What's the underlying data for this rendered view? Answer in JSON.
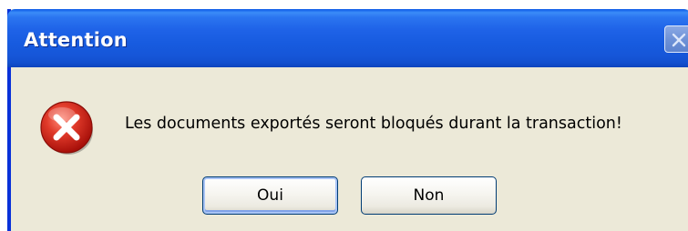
{
  "dialog": {
    "title": "Attention",
    "message": "Les documents exportés seront bloqués durant la transaction!",
    "icon": "error-icon",
    "buttons": {
      "yes_label": "Oui",
      "no_label": "Non"
    },
    "colors": {
      "titlebar": "#1f63e8",
      "body": "#ece9d8",
      "error_red": "#d6231c"
    }
  }
}
